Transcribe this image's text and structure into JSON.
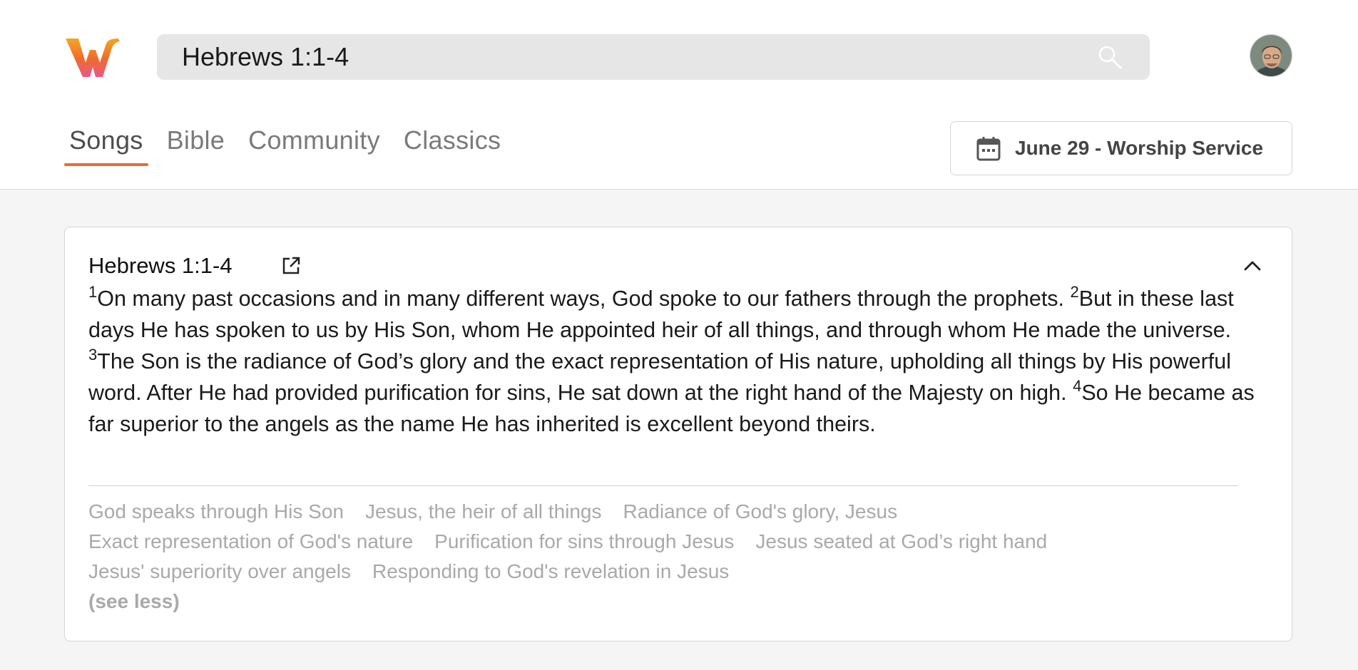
{
  "header": {
    "search_value": "Hebrews 1:1-4",
    "search_icon": "search-icon",
    "avatar_icon": "user-avatar",
    "brand_colors": {
      "orange": "#ee6a2f",
      "pink": "#e85a8a",
      "yellow": "#f5b042"
    }
  },
  "tabs": [
    {
      "label": "Songs",
      "active": true
    },
    {
      "label": "Bible",
      "active": false
    },
    {
      "label": "Community",
      "active": false
    },
    {
      "label": "Classics",
      "active": false
    }
  ],
  "service": {
    "label": "June 29 - Worship Service",
    "icon": "calendar-icon"
  },
  "card": {
    "title": "Hebrews 1:1-4",
    "open_icon": "external-link-icon",
    "collapse_icon": "chevron-up-icon",
    "verses": [
      {
        "num": "1",
        "text": "On many past occasions and in many different ways, God spoke to our fathers through the prophets. "
      },
      {
        "num": "2",
        "text": "But in these last days He has spoken to us by His Son, whom He appointed heir of all things, and through whom He made the universe. "
      },
      {
        "num": "3",
        "text": "The Son is the radiance of God’s glory and the exact representation of His nature, upholding all things by His powerful word. After He had provided purification for sins, He sat down at the right hand of the Majesty on high. "
      },
      {
        "num": "4",
        "text": "So He became as far superior to the angels as the name He has inherited is excellent beyond theirs."
      }
    ],
    "topic_rows": [
      [
        "God speaks through His Son",
        "Jesus, the heir of all things",
        "Radiance of God's glory, Jesus"
      ],
      [
        "Exact representation of God's nature",
        "Purification for sins through Jesus",
        "Jesus seated at God’s right hand"
      ],
      [
        "Jesus' superiority over angels",
        "Responding to God's revelation in Jesus"
      ]
    ],
    "see_less_label": "(see less)"
  }
}
